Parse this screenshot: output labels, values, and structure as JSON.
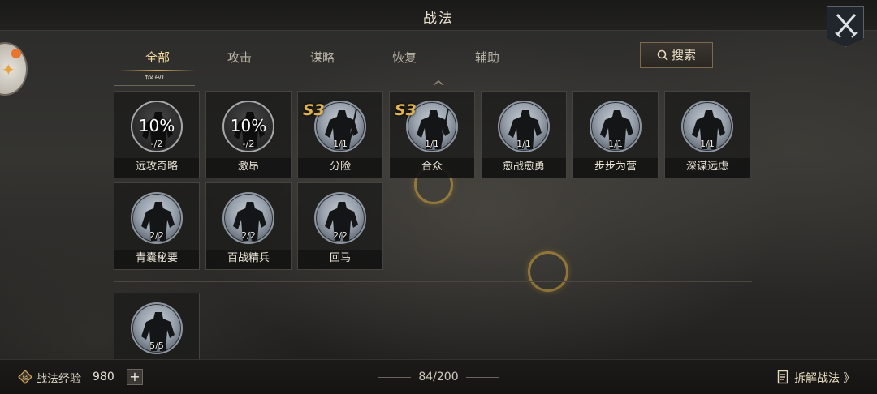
{
  "header": {
    "title": "战法"
  },
  "tabs": [
    {
      "label": "全部",
      "active": true
    },
    {
      "label": "攻击",
      "active": false
    },
    {
      "label": "谋略",
      "active": false
    },
    {
      "label": "恢复",
      "active": false
    },
    {
      "label": "辅助",
      "active": false
    }
  ],
  "search": {
    "label": "搜索"
  },
  "section_header_partial": "被动",
  "cards": [
    {
      "name": "远攻奇略",
      "badge": "10%",
      "count": "-/2",
      "style": "dark"
    },
    {
      "name": "激昂",
      "badge": "10%",
      "count": "-/2",
      "style": "dark"
    },
    {
      "name": "分险",
      "season": "S3",
      "count": "1/1",
      "style": "light"
    },
    {
      "name": "合众",
      "season": "S3",
      "count": "1/1",
      "style": "light"
    },
    {
      "name": "愈战愈勇",
      "count": "1/1",
      "style": "light"
    },
    {
      "name": "步步为营",
      "count": "1/1",
      "style": "light"
    },
    {
      "name": "深谋远虑",
      "count": "1/1",
      "style": "light"
    },
    {
      "name": "青囊秘要",
      "count": "2/2",
      "style": "light"
    },
    {
      "name": "百战精兵",
      "count": "2/2",
      "style": "light"
    },
    {
      "name": "回马",
      "count": "2/2",
      "style": "light"
    },
    {
      "name": "",
      "count": "5/5",
      "style": "light"
    }
  ],
  "footer": {
    "exp_label": "战法经验",
    "exp_value": "980",
    "plus_label": "+",
    "page_count": "84/200",
    "dismantle_label": "拆解战法 》"
  },
  "icons": {
    "close": "crossed-swords-close-icon",
    "search": "search-icon",
    "exp": "exp-badge-icon",
    "dismantle": "document-list-icon"
  },
  "colors": {
    "accent_gold": "#d6ad5e",
    "season_tag": "#e2b24e",
    "text_light": "#e8e2d4"
  }
}
